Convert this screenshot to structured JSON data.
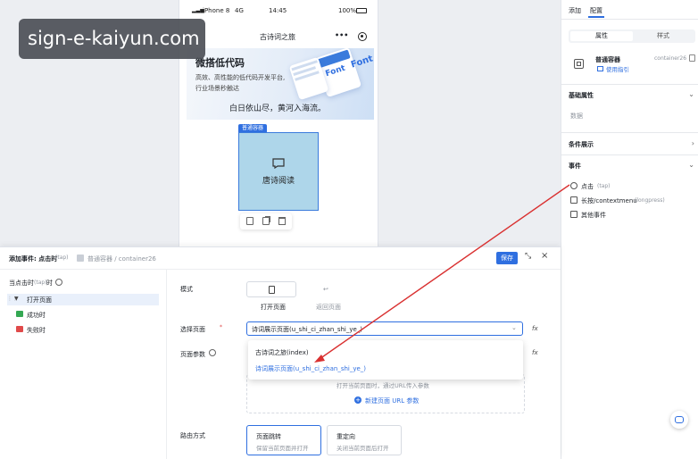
{
  "watermark": "sign-e-kaiyun.com",
  "phone": {
    "carrier": "iPhone 8",
    "network": "4G",
    "time": "14:45",
    "battery": "100%",
    "title": "古诗词之旅",
    "more": "•••",
    "banner": {
      "heading": "微搭低代码",
      "line1": "高效、高性能的低代码开发平台,",
      "line2": "行业场景秒触达",
      "poem": "白日依山尽，黄河入海流。",
      "card_text_a": "Font",
      "card_text_b": "Font"
    },
    "container": {
      "tag": "普通容器",
      "label": "唐诗阅读"
    }
  },
  "right_panel": {
    "tabs": [
      "添加",
      "配置"
    ],
    "subtabs": [
      "属性",
      "样式"
    ],
    "component_name": "普通容器",
    "component_id": "container26",
    "guide": "使用指引",
    "basic_props": "基础属性",
    "data_label": "数据",
    "condition": "条件展示",
    "events": "事件",
    "event_tap": "点击",
    "event_tap_code": "(tap)",
    "event_long": "长按/contextmenu",
    "event_long_code": "(longpress)",
    "event_other": "其他事件"
  },
  "dialog": {
    "title": "添加事件: 点击时",
    "title_code": "(tap)",
    "breadcrumb": "普通容器 / container26",
    "save": "保存",
    "tree_root": "当点击时",
    "tree_root_code": "(tap)",
    "tree_root_suffix": "时",
    "action": "打开页面",
    "success": "成功时",
    "fail": "失败时",
    "mode_label": "模式",
    "mode_open": "打开页面",
    "mode_back": "返回页面",
    "select_page_label": "选择页面",
    "selected_page": "诗词展示页面(u_shi_ci_zhan_shi_ye_)",
    "page_params_label": "页面参数",
    "dropdown_options": [
      "古诗词之旅(index)",
      "诗词展示页面(u_shi_ci_zhan_shi_ye_)"
    ],
    "param_hint": "打开当前页面时，通过URL传入参数",
    "add_param": "新建页面 URL 参数",
    "route_label": "路由方式",
    "route_nav": "页面跳转",
    "route_nav_desc": "保留当前页面并打开",
    "route_redirect": "重定向",
    "route_redirect_desc": "关闭当前页面后打开",
    "fx": "fx"
  },
  "colors": {
    "accent": "#2f6fe0",
    "container_fill": "#aed6ea",
    "arrow": "#d93030"
  }
}
